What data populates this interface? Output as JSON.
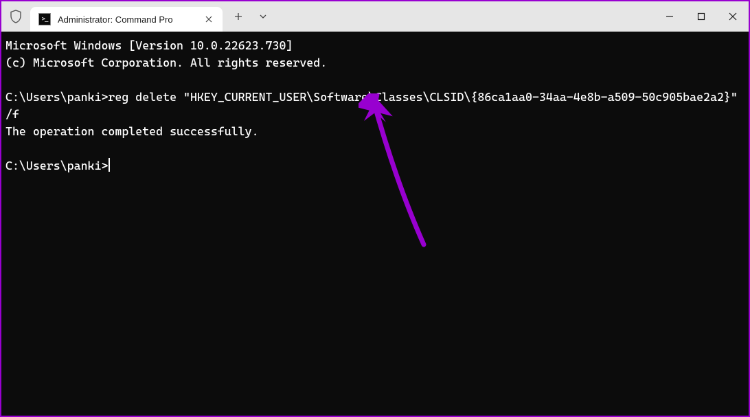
{
  "window": {
    "tab_title": "Administrator: Command Pro",
    "tab_icon_text": ">_"
  },
  "terminal": {
    "line1": "Microsoft Windows [Version 10.0.22623.730]",
    "line2": "(c) Microsoft Corporation. All rights reserved.",
    "blank1": "",
    "prompt1": "C:\\Users\\panki>",
    "command": "reg delete \"HKEY_CURRENT_USER\\Software\\Classes\\CLSID\\{86ca1aa0-34aa-4e8b-a509-50c905bae2a2}\" /f",
    "result": "The operation completed successfully.",
    "blank2": "",
    "prompt2": "C:\\Users\\panki>"
  },
  "annotation": {
    "color": "#9800d0"
  }
}
